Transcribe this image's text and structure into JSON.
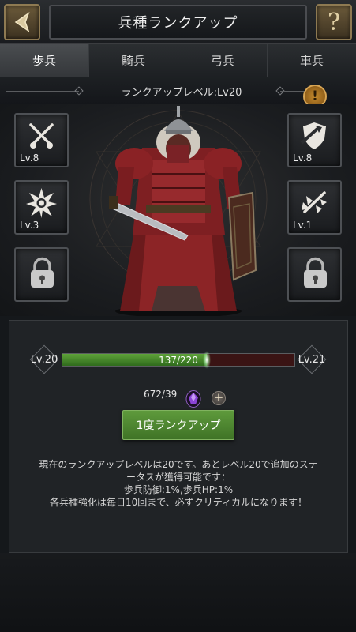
{
  "header": {
    "title": "兵種ランクアップ",
    "back_icon": "back-arrow-icon",
    "help_label": "?"
  },
  "tabs": [
    {
      "label": "歩兵",
      "active": true
    },
    {
      "label": "騎兵",
      "active": false
    },
    {
      "label": "弓兵",
      "active": false
    },
    {
      "label": "車兵",
      "active": false
    }
  ],
  "rank_level_label": "ランクアップレベル:Lv20",
  "info_button_label": "!",
  "skills_left": [
    {
      "icon": "crossed-swords-icon",
      "level": "Lv.8"
    },
    {
      "icon": "starburst-icon",
      "level": "Lv.3"
    },
    {
      "icon": "lock-icon",
      "level": ""
    }
  ],
  "skills_right": [
    {
      "icon": "shield-strike-icon",
      "level": "Lv.8"
    },
    {
      "icon": "shatter-icon",
      "level": "Lv.1"
    },
    {
      "icon": "lock-icon",
      "level": ""
    }
  ],
  "progress": {
    "current_level": "Lv.20",
    "next_level": "Lv.21",
    "text": "137/220",
    "current": 137,
    "max": 220
  },
  "cost": {
    "text": "672/39",
    "icon": "purple-gem-icon",
    "add_icon": "plus-icon"
  },
  "rankup_button": "1度ランクアップ",
  "description": [
    "現在のランクアップレベルは20です。あとレベル20で追加のステ",
    "ータスが獲得可能です：",
    "歩兵防御:1%,歩兵HP:1%",
    "各兵種強化は毎日10回まで、必ずクリティカルになります！"
  ],
  "colors": {
    "accent_green": "#4f8a31",
    "progress_empty": "#3a1414",
    "gold_frame": "#8e7a52"
  }
}
